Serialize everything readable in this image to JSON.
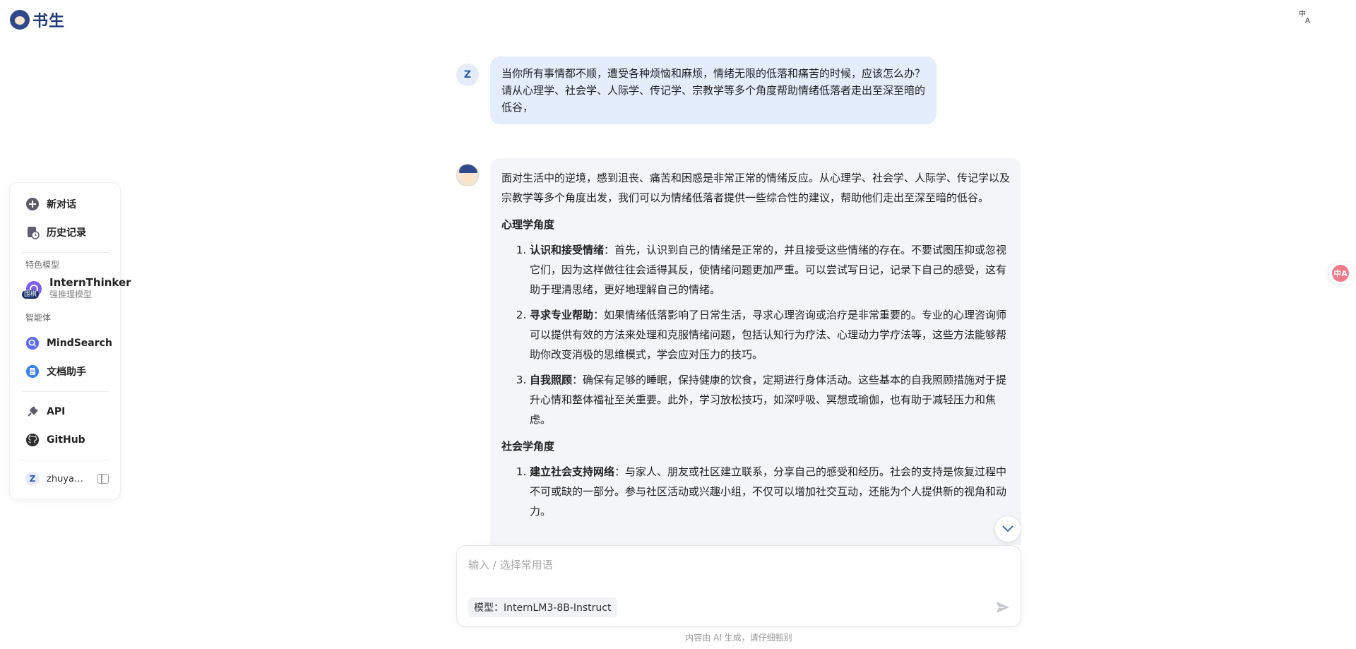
{
  "brand": {
    "name": "书生"
  },
  "header": {
    "language_icon": "translate-icon",
    "language_glyph": "中A"
  },
  "sidebar": {
    "new_chat": "新对话",
    "history": "历史记录",
    "featured_section": "特色模型",
    "thinker": {
      "name": "InternThinker",
      "subtitle": "强推理模型",
      "badge": "围棋"
    },
    "agents_section": "智能体",
    "mindsearch": "MindSearch",
    "doc_assistant": "文档助手",
    "api": "API",
    "github": "GitHub",
    "user": {
      "initial": "Z",
      "name": "zhuya…"
    }
  },
  "chat": {
    "user_initial": "Z",
    "user_message": "当你所有事情都不顺，遭受各种烦恼和麻烦，情绪无限的低落和痛苦的时候，应该怎么办？请从心理学、社会学、人际学、传记学、宗教学等多个角度帮助情绪低落者走出至深至暗的低谷，",
    "ai": {
      "intro": "面对生活中的逆境，感到沮丧、痛苦和困惑是非常正常的情绪反应。从心理学、社会学、人际学、传记学以及宗教学等多个角度出发，我们可以为情绪低落者提供一些综合性的建议，帮助他们走出至深至暗的低谷。",
      "section1": {
        "title": "心理学角度",
        "items": [
          {
            "bold": "认识和接受情绪",
            "text": "：首先，认识到自己的情绪是正常的，并且接受这些情绪的存在。不要试图压抑或忽视它们，因为这样做往往会适得其反，使情绪问题更加严重。可以尝试写日记，记录下自己的感受，这有助于理清思绪，更好地理解自己的情绪。"
          },
          {
            "bold": "寻求专业帮助",
            "text": "：如果情绪低落影响了日常生活，寻求心理咨询或治疗是非常重要的。专业的心理咨询师可以提供有效的方法来处理和克服情绪问题，包括认知行为疗法、心理动力学疗法等，这些方法能够帮助你改变消极的思维模式，学会应对压力的技巧。"
          },
          {
            "bold": "自我照顾",
            "text": "：确保有足够的睡眠，保持健康的饮食，定期进行身体活动。这些基本的自我照顾措施对于提升心情和整体福祉至关重要。此外，学习放松技巧，如深呼吸、冥想或瑜伽，也有助于减轻压力和焦虑。"
          }
        ]
      },
      "section2": {
        "title": "社会学角度",
        "items": [
          {
            "bold": "建立社会支持网络",
            "text": "：与家人、朋友或社区建立联系，分享自己的感受和经历。社会的支持是恢复过程中不可或缺的一部分。参与社区活动或兴趣小组，不仅可以增加社交互动，还能为个人提供新的视角和动力。"
          }
        ]
      }
    }
  },
  "composer": {
    "placeholder": "输入 / 选择常用语",
    "model_label": "模型：InternLM3-8B-Instruct"
  },
  "footer": {
    "disclaimer": "内容由 AI 生成，请仔细甄别"
  },
  "colors": {
    "accent": "#2b5bb8",
    "user_bubble": "#e3edfc",
    "ai_bubble": "#f4f5f8",
    "brand": "#1f3a7a"
  }
}
